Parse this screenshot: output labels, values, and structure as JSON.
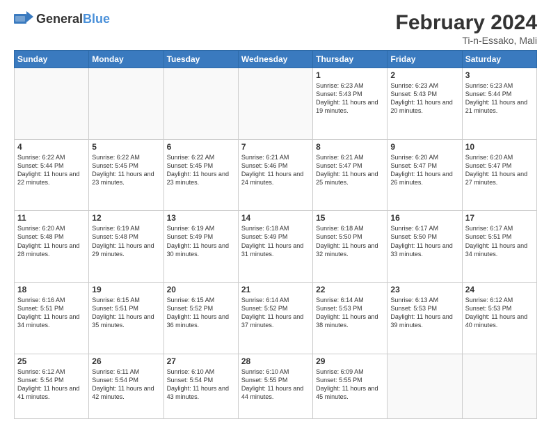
{
  "header": {
    "logo_general": "General",
    "logo_blue": "Blue",
    "title": "February 2024",
    "location": "Ti-n-Essako, Mali"
  },
  "days_of_week": [
    "Sunday",
    "Monday",
    "Tuesday",
    "Wednesday",
    "Thursday",
    "Friday",
    "Saturday"
  ],
  "weeks": [
    [
      {
        "day": "",
        "info": ""
      },
      {
        "day": "",
        "info": ""
      },
      {
        "day": "",
        "info": ""
      },
      {
        "day": "",
        "info": ""
      },
      {
        "day": "1",
        "info": "Sunrise: 6:23 AM\nSunset: 5:43 PM\nDaylight: 11 hours and 19 minutes."
      },
      {
        "day": "2",
        "info": "Sunrise: 6:23 AM\nSunset: 5:43 PM\nDaylight: 11 hours and 20 minutes."
      },
      {
        "day": "3",
        "info": "Sunrise: 6:23 AM\nSunset: 5:44 PM\nDaylight: 11 hours and 21 minutes."
      }
    ],
    [
      {
        "day": "4",
        "info": "Sunrise: 6:22 AM\nSunset: 5:44 PM\nDaylight: 11 hours and 22 minutes."
      },
      {
        "day": "5",
        "info": "Sunrise: 6:22 AM\nSunset: 5:45 PM\nDaylight: 11 hours and 23 minutes."
      },
      {
        "day": "6",
        "info": "Sunrise: 6:22 AM\nSunset: 5:45 PM\nDaylight: 11 hours and 23 minutes."
      },
      {
        "day": "7",
        "info": "Sunrise: 6:21 AM\nSunset: 5:46 PM\nDaylight: 11 hours and 24 minutes."
      },
      {
        "day": "8",
        "info": "Sunrise: 6:21 AM\nSunset: 5:47 PM\nDaylight: 11 hours and 25 minutes."
      },
      {
        "day": "9",
        "info": "Sunrise: 6:20 AM\nSunset: 5:47 PM\nDaylight: 11 hours and 26 minutes."
      },
      {
        "day": "10",
        "info": "Sunrise: 6:20 AM\nSunset: 5:47 PM\nDaylight: 11 hours and 27 minutes."
      }
    ],
    [
      {
        "day": "11",
        "info": "Sunrise: 6:20 AM\nSunset: 5:48 PM\nDaylight: 11 hours and 28 minutes."
      },
      {
        "day": "12",
        "info": "Sunrise: 6:19 AM\nSunset: 5:48 PM\nDaylight: 11 hours and 29 minutes."
      },
      {
        "day": "13",
        "info": "Sunrise: 6:19 AM\nSunset: 5:49 PM\nDaylight: 11 hours and 30 minutes."
      },
      {
        "day": "14",
        "info": "Sunrise: 6:18 AM\nSunset: 5:49 PM\nDaylight: 11 hours and 31 minutes."
      },
      {
        "day": "15",
        "info": "Sunrise: 6:18 AM\nSunset: 5:50 PM\nDaylight: 11 hours and 32 minutes."
      },
      {
        "day": "16",
        "info": "Sunrise: 6:17 AM\nSunset: 5:50 PM\nDaylight: 11 hours and 33 minutes."
      },
      {
        "day": "17",
        "info": "Sunrise: 6:17 AM\nSunset: 5:51 PM\nDaylight: 11 hours and 34 minutes."
      }
    ],
    [
      {
        "day": "18",
        "info": "Sunrise: 6:16 AM\nSunset: 5:51 PM\nDaylight: 11 hours and 34 minutes."
      },
      {
        "day": "19",
        "info": "Sunrise: 6:15 AM\nSunset: 5:51 PM\nDaylight: 11 hours and 35 minutes."
      },
      {
        "day": "20",
        "info": "Sunrise: 6:15 AM\nSunset: 5:52 PM\nDaylight: 11 hours and 36 minutes."
      },
      {
        "day": "21",
        "info": "Sunrise: 6:14 AM\nSunset: 5:52 PM\nDaylight: 11 hours and 37 minutes."
      },
      {
        "day": "22",
        "info": "Sunrise: 6:14 AM\nSunset: 5:53 PM\nDaylight: 11 hours and 38 minutes."
      },
      {
        "day": "23",
        "info": "Sunrise: 6:13 AM\nSunset: 5:53 PM\nDaylight: 11 hours and 39 minutes."
      },
      {
        "day": "24",
        "info": "Sunrise: 6:12 AM\nSunset: 5:53 PM\nDaylight: 11 hours and 40 minutes."
      }
    ],
    [
      {
        "day": "25",
        "info": "Sunrise: 6:12 AM\nSunset: 5:54 PM\nDaylight: 11 hours and 41 minutes."
      },
      {
        "day": "26",
        "info": "Sunrise: 6:11 AM\nSunset: 5:54 PM\nDaylight: 11 hours and 42 minutes."
      },
      {
        "day": "27",
        "info": "Sunrise: 6:10 AM\nSunset: 5:54 PM\nDaylight: 11 hours and 43 minutes."
      },
      {
        "day": "28",
        "info": "Sunrise: 6:10 AM\nSunset: 5:55 PM\nDaylight: 11 hours and 44 minutes."
      },
      {
        "day": "29",
        "info": "Sunrise: 6:09 AM\nSunset: 5:55 PM\nDaylight: 11 hours and 45 minutes."
      },
      {
        "day": "",
        "info": ""
      },
      {
        "day": "",
        "info": ""
      }
    ]
  ]
}
